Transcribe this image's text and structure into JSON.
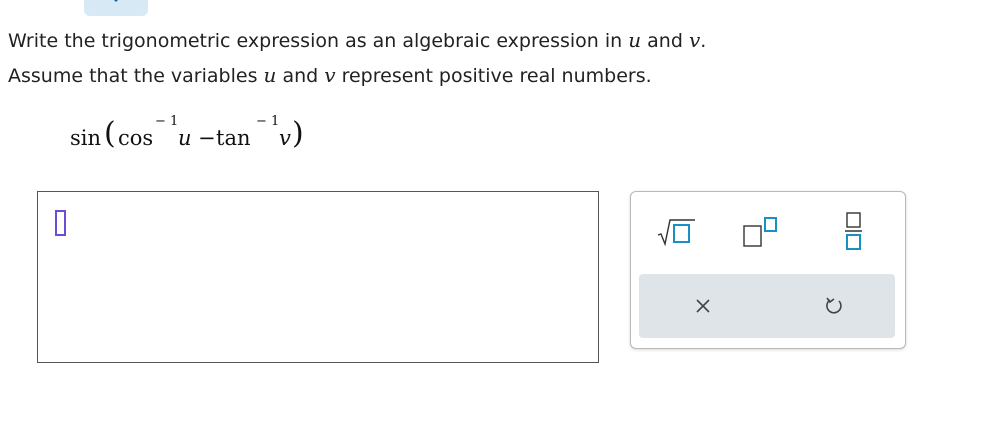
{
  "prompt": {
    "line1_pre": "Write the trigonometric expression as an algebraic expression in ",
    "var_u": "u",
    "line1_mid": " and ",
    "var_v": "v",
    "line1_end": ".",
    "line2_pre": "Assume that the variables ",
    "line2_mid": " and ",
    "line2_end": " represent positive real numbers."
  },
  "expression": {
    "sin": "sin",
    "open": "(",
    "cos": "cos",
    "inv": "− 1",
    "u": "u",
    "minus": "−",
    "tan": "tan",
    "v": "v",
    "close": ")"
  },
  "palette": {
    "sqrt_icon": "square-root-icon",
    "exponent_icon": "exponent-icon",
    "fraction_icon": "fraction-icon",
    "clear_icon": "close-icon",
    "undo_icon": "undo-icon"
  },
  "colors": {
    "accent": "#1a8fc4",
    "cursor": "#6d4cd6",
    "action_bar": "#dfe4e8"
  }
}
